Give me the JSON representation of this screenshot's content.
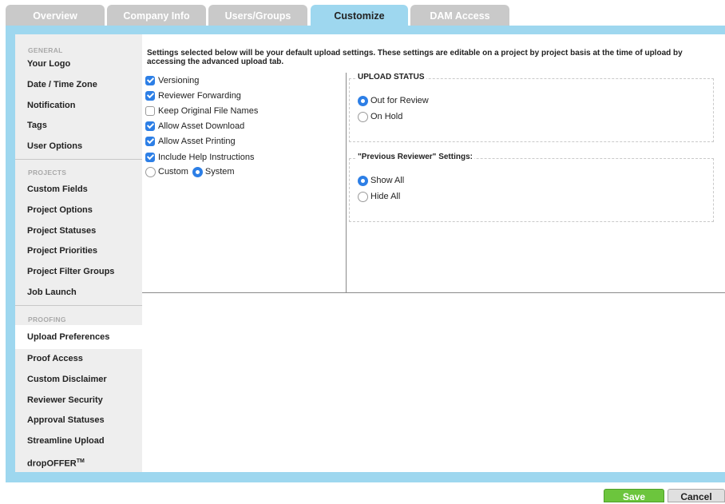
{
  "tabs": [
    {
      "label": "Overview"
    },
    {
      "label": "Company Info"
    },
    {
      "label": "Users/Groups"
    },
    {
      "label": "Customize"
    },
    {
      "label": "DAM Access"
    }
  ],
  "sidebar": {
    "general_header": "GENERAL",
    "general_items": [
      {
        "label": "Your Logo"
      },
      {
        "label": "Date / Time Zone"
      },
      {
        "label": "Notification"
      },
      {
        "label": "Tags"
      },
      {
        "label": "User Options"
      }
    ],
    "projects_header": "PROJECTS",
    "projects_items": [
      {
        "label": "Custom Fields"
      },
      {
        "label": "Project Options"
      },
      {
        "label": "Project Statuses"
      },
      {
        "label": "Project Priorities"
      },
      {
        "label": "Project Filter Groups"
      },
      {
        "label": "Job Launch"
      }
    ],
    "proofing_header": "PROOFING",
    "proofing_items": [
      {
        "label": "Upload Preferences"
      },
      {
        "label": "Proof Access"
      },
      {
        "label": "Custom Disclaimer"
      },
      {
        "label": "Reviewer Security"
      },
      {
        "label": "Approval Statuses"
      },
      {
        "label": "Streamline Upload"
      },
      {
        "label": "dropOFFER",
        "sup": "TM"
      }
    ]
  },
  "content": {
    "intro": "Settings selected below will be your default upload settings. These settings are editable on a project by project basis at the time of upload by accessing the advanced upload tab.",
    "options": [
      {
        "label": "Versioning",
        "checked": true
      },
      {
        "label": "Reviewer Forwarding",
        "checked": true
      },
      {
        "label": "Keep Original File Names",
        "checked": false
      },
      {
        "label": "Allow Asset Download",
        "checked": true
      },
      {
        "label": "Allow Asset Printing",
        "checked": true
      },
      {
        "label": "Include Help Instructions",
        "checked": true
      }
    ],
    "help_mode": {
      "custom": "Custom",
      "system": "System",
      "selected": "System"
    },
    "upload_status": {
      "legend": "UPLOAD STATUS",
      "options": [
        "Out for Review",
        "On Hold"
      ],
      "selected": "Out for Review"
    },
    "previous_reviewer": {
      "legend": "\"Previous Reviewer\" Settings:",
      "options": [
        "Show All",
        "Hide All"
      ],
      "selected": "Show All"
    }
  },
  "footer": {
    "save": "Save",
    "cancel": "Cancel"
  },
  "colors": {
    "accent": "#9ed7ef",
    "checkbox": "#2d7fe6",
    "save": "#6cc53d"
  }
}
